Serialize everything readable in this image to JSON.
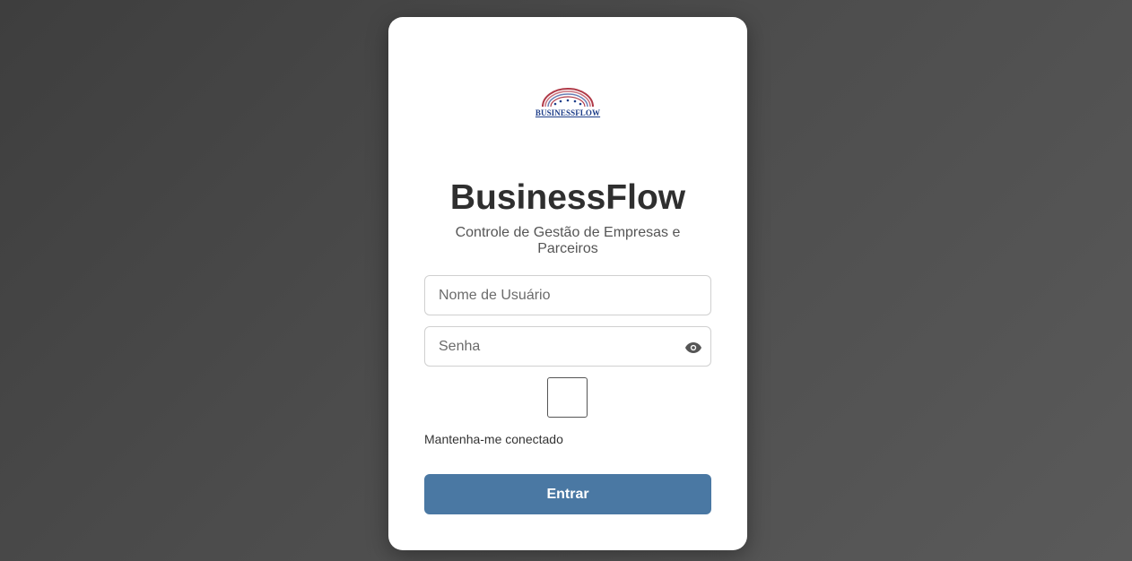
{
  "logo": {
    "text": "BUSINESSFLOW",
    "icon": "rainbow-arch-logo-icon",
    "colors": {
      "arch_outer": "#b03a48",
      "arch_inner": "#6a7fb5",
      "stars": "#1f3f8a"
    }
  },
  "header": {
    "title": "BusinessFlow",
    "subtitle": "Controle de Gestão de Empresas e Parceiros"
  },
  "form": {
    "username_placeholder": "Nome de Usuário",
    "username_value": "",
    "password_placeholder": "Senha",
    "password_value": "",
    "password_toggle_icon": "eye-icon",
    "remember_label": "Mantenha-me conectado",
    "remember_checked": false,
    "submit_label": "Entrar"
  },
  "colors": {
    "background": "#4a4a4a",
    "card": "#ffffff",
    "primary_button": "#4a78a3",
    "title_text": "#2f2f2f"
  }
}
